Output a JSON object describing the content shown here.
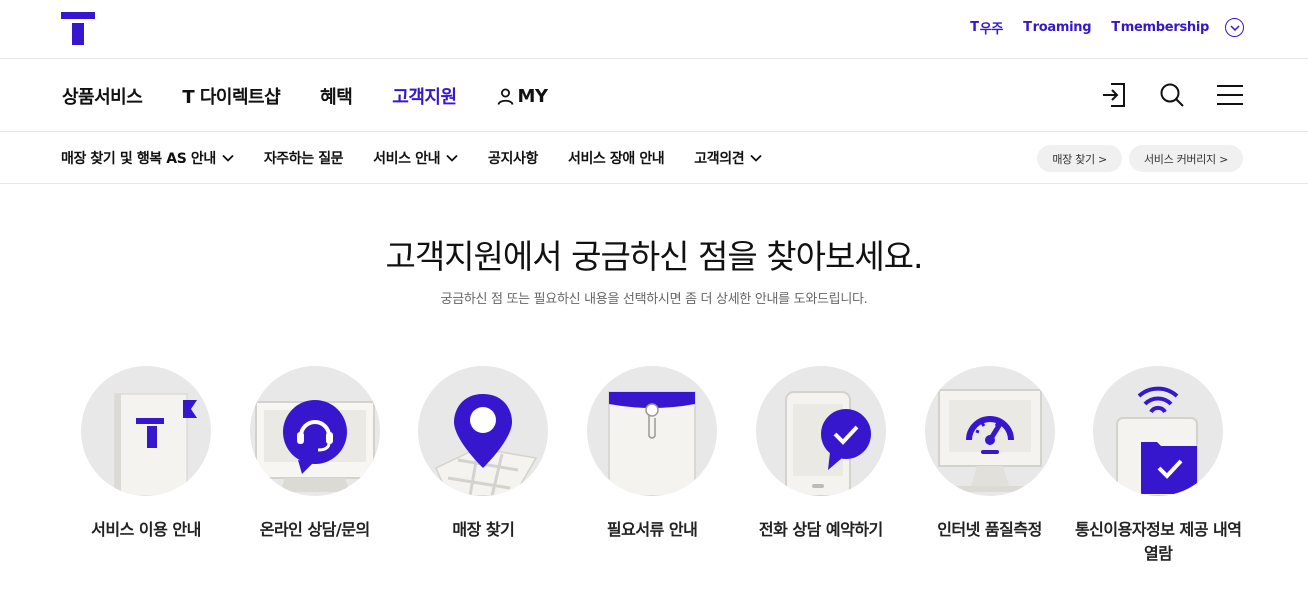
{
  "brand": {
    "logo_name": "T"
  },
  "util_links": [
    {
      "mark": "T",
      "label": "우주"
    },
    {
      "mark": "T",
      "label": "roaming"
    },
    {
      "mark": "T",
      "label": "membership"
    }
  ],
  "gnb": {
    "items": [
      "상품서비스",
      "T 다이렉트샵",
      "혜택",
      "고객지원"
    ],
    "my_label": "MY",
    "active_item": "고객지원"
  },
  "lnb": {
    "items": [
      {
        "label": "매장 찾기 및 행복 AS 안내",
        "dropdown": true
      },
      {
        "label": "자주하는 질문",
        "dropdown": false
      },
      {
        "label": "서비스 안내",
        "dropdown": true
      },
      {
        "label": "공지사항",
        "dropdown": false
      },
      {
        "label": "서비스 장애 안내",
        "dropdown": false
      },
      {
        "label": "고객의견",
        "dropdown": true
      }
    ],
    "quick_buttons": [
      "매장 찾기 >",
      "서비스 커버리지 >"
    ]
  },
  "hero": {
    "title": "고객지원에서 궁금하신 점을 찾아보세요.",
    "subtitle": "궁금하신 점 또는 필요하신 내용을 선택하시면 좀 더 상세한 안내를 도와드립니다."
  },
  "cards": [
    {
      "label": "서비스 이용 안내",
      "icon": "service-guide-icon"
    },
    {
      "label": "온라인 상담/문의",
      "icon": "headset-chat-icon"
    },
    {
      "label": "매장 찾기",
      "icon": "map-pin-icon"
    },
    {
      "label": "필요서류 안내",
      "icon": "document-envelope-icon"
    },
    {
      "label": "전화 상담 예약하기",
      "icon": "phone-check-icon"
    },
    {
      "label": "인터넷 품질측정",
      "icon": "speed-meter-icon"
    },
    {
      "label": "통신이용자정보 제공 내역 열람",
      "icon": "wifi-folder-check-icon"
    }
  ],
  "colors": {
    "accent": "#3617ce",
    "circle_bg": "#e8e8e8",
    "text": "#111111"
  }
}
